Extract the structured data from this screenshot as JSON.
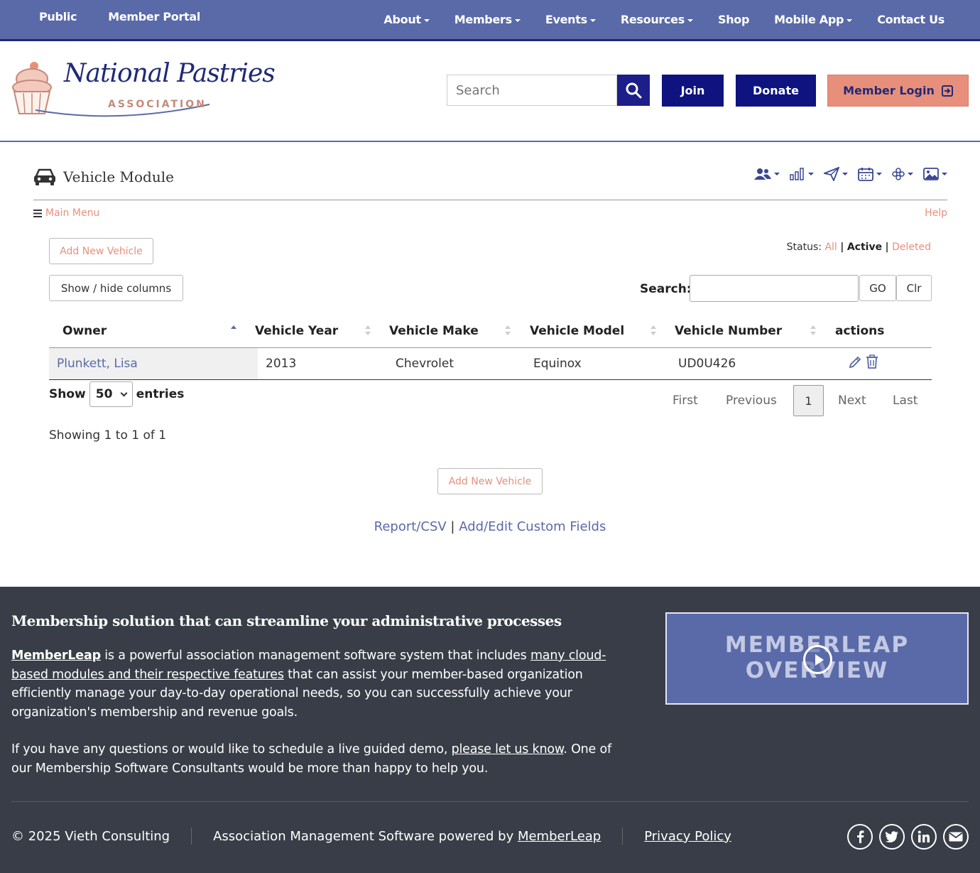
{
  "topnav": {
    "left": [
      "Public",
      "Member Portal"
    ],
    "right": [
      {
        "label": "About",
        "dropdown": true
      },
      {
        "label": "Members",
        "dropdown": true
      },
      {
        "label": "Events",
        "dropdown": true
      },
      {
        "label": "Resources",
        "dropdown": true
      },
      {
        "label": "Shop",
        "dropdown": false
      },
      {
        "label": "Mobile App",
        "dropdown": true
      },
      {
        "label": "Contact Us",
        "dropdown": false
      }
    ]
  },
  "header": {
    "logo_script": "National Pastries",
    "logo_sub": "ASSOCIATION",
    "search_placeholder": "Search",
    "join": "Join",
    "donate": "Donate",
    "member_login": "Member Login"
  },
  "module": {
    "title": "Vehicle Module",
    "toolbar_icons": [
      "users-icon",
      "bar-chart-icon",
      "paper-plane-icon",
      "calendar-icon",
      "asterisk-icon",
      "image-icon"
    ],
    "main_menu": "Main Menu",
    "help": "Help",
    "add_new_vehicle": "Add New Vehicle",
    "show_hide_columns": "Show / hide columns",
    "status_label": "Status:",
    "status_all": "All",
    "status_active": "Active",
    "status_deleted": "Deleted",
    "search_label": "Search:",
    "go": "GO",
    "clr": "Clr"
  },
  "table": {
    "columns": [
      "Owner",
      "Vehicle Year",
      "Vehicle Make",
      "Vehicle Model",
      "Vehicle Number",
      "actions"
    ],
    "rows": [
      {
        "owner": "Plunkett, Lisa",
        "year": "2013",
        "make": "Chevrolet",
        "model": "Equinox",
        "number": "UD0U426"
      }
    ]
  },
  "paging": {
    "show": "Show",
    "entries_value": "50",
    "entries": "entries",
    "first": "First",
    "previous": "Previous",
    "current": "1",
    "next": "Next",
    "last": "Last",
    "showing": "Showing 1 to 1 of 1"
  },
  "bottom_links": {
    "report": "Report/CSV",
    "sep": "|",
    "custom_fields": "Add/Edit Custom Fields"
  },
  "footer": {
    "title": "Membership solution that can streamline your administrative processes",
    "p1_link1": "MemberLeap",
    "p1_text1": " is a powerful association management software system that includes ",
    "p1_link2": "many cloud-based modules and their respective features",
    "p1_text2": " that can assist your member-based organization efficiently manage your day-to-day operational needs, so you can successfully achieve your organization's membership and revenue goals.",
    "p2_text1": "If you have any questions or would like to schedule a live guided demo, ",
    "p2_link": "please let us know",
    "p2_text2": ". One of our Membership Software Consultants would be more than happy to help you.",
    "video_line1": "MEMBERLEAP",
    "video_line2": "OVERVIEW",
    "copyright": "© 2025 Vieth Consulting",
    "powered_text": "Association Management Software powered by ",
    "powered_link": "MemberLeap",
    "privacy": "Privacy Policy",
    "social": [
      "facebook-icon",
      "twitter-icon",
      "linkedin-icon",
      "email-icon"
    ]
  },
  "colors": {
    "nav": "#5a6aa8",
    "navy_button": "#0e1380",
    "accent_salmon": "#e88f7b",
    "footer_bg": "#383d47"
  }
}
